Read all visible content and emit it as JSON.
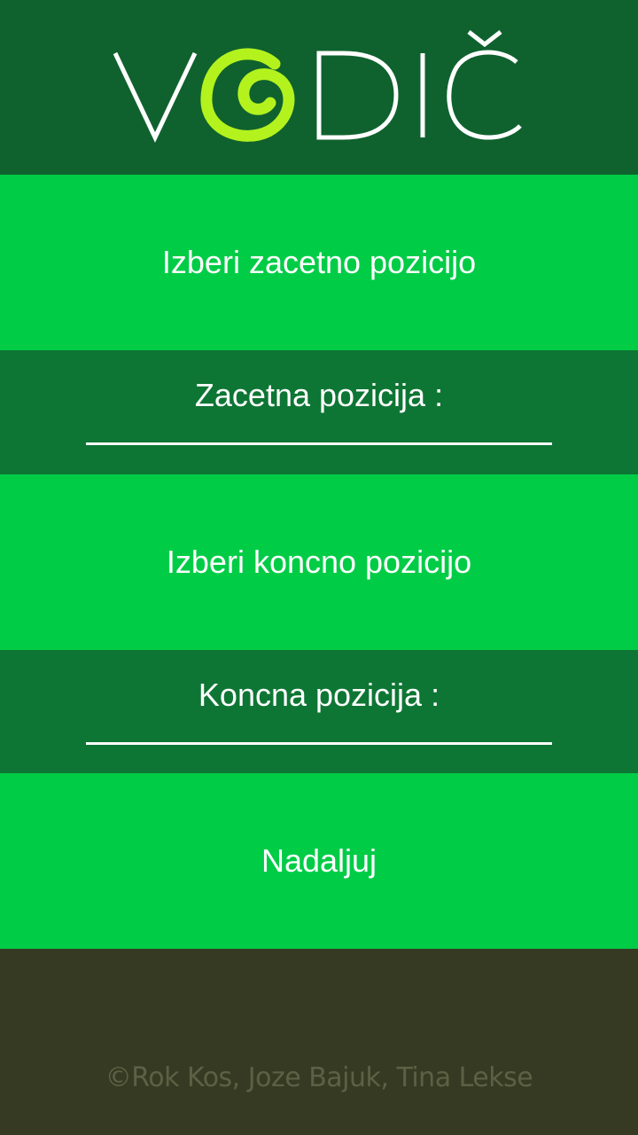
{
  "header": {
    "logo_text": "VGDIČ",
    "logo_colors": {
      "letters": "#ffffff",
      "spiral": "#b4f21e"
    }
  },
  "start": {
    "button_label": "Izberi zacetno pozicijo",
    "field_label": "Zacetna pozicija :"
  },
  "end": {
    "button_label": "Izberi koncno pozicijo",
    "field_label": "Koncna pozicija :"
  },
  "continue": {
    "button_label": "Nadaljuj"
  },
  "footer": {
    "credits": "©Rok Kos, Joze Bajuk, Tina Lekse"
  },
  "colors": {
    "header_bg": "#0f622e",
    "button_bg": "#00cc46",
    "info_bg": "#0e7634",
    "footer_bg": "#363a22"
  }
}
